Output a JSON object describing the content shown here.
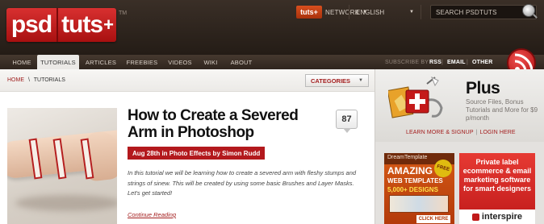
{
  "header": {
    "logo": {
      "word1": "psd",
      "word2": "tuts",
      "plus": "+",
      "tm": "TM"
    },
    "network_badge": "tuts+",
    "network_label": "NETWORK",
    "language_label": "ENGLISH",
    "search_placeholder": "SEARCH PSDTUTS"
  },
  "nav": {
    "items": [
      "HOME",
      "TUTORIALS",
      "ARTICLES",
      "FREEBIES",
      "VIDEOS",
      "WIKI",
      "ABOUT"
    ],
    "active_index": 1,
    "subscribe_label": "SUBSCRIBE BY",
    "subscribe_links": [
      "RSS",
      "EMAIL",
      "OTHER"
    ],
    "subscribe_sep": "|"
  },
  "breadcrumb": {
    "home": "HOME",
    "sep": "\\",
    "current": "TUTORIALS"
  },
  "categories_button": "CATEGORIES",
  "article": {
    "title": "How to Create a Severed Arm in Photoshop",
    "comment_count": "87",
    "meta": "Aug 28th in Photo Effects by Simon Rudd",
    "excerpt": "In this tutorial we will be learning how to create a severed arm with fleshy stumps and strings of sinew. This will be created by using some basic Brushes and Layer Masks. Let's get started!",
    "continue_label": "Continue Reading"
  },
  "sidebar": {
    "plus": {
      "title": "Plus",
      "description": "Source Files, Bonus Tutorials and More for $9 p/month",
      "link_learn": "LEARN MORE & SIGNUP",
      "link_sep": "|",
      "link_login": "LOGIN HERE"
    },
    "ad_dreamtemplate": {
      "brand": "DreamTemplate",
      "headline": "AMAZING",
      "subhead": "WEB TEMPLATES",
      "count": "5,000+ DESIGNS",
      "badge": "FREE",
      "cta": "CLICK HERE"
    },
    "ad_interspire": {
      "text": "Private label ecommerce & email marketing software for smart designers",
      "brand": "interspire"
    }
  },
  "colors": {
    "brand_red": "#b3191d",
    "header_bg": "#2b221c",
    "link_red": "#a31d1d"
  }
}
